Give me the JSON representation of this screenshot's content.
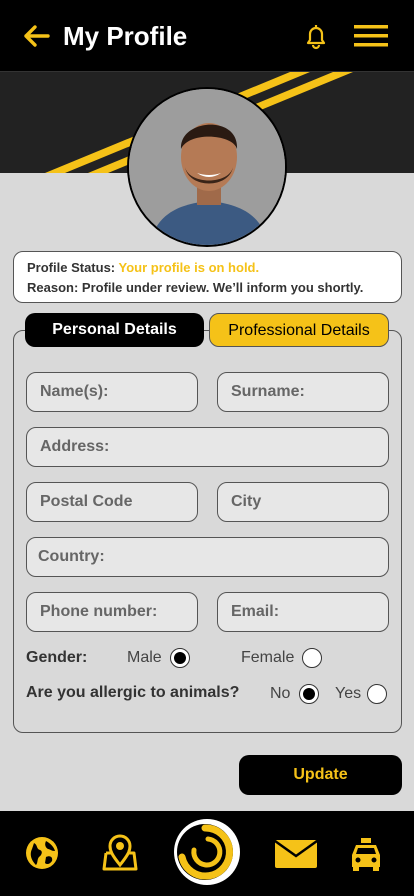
{
  "header": {
    "title": "My Profile"
  },
  "status": {
    "status_label": "Profile Status:",
    "status_value": "Your profile is on hold.",
    "reason_label": "Reason:",
    "reason_value": "Profile under review. We’ll inform you shortly."
  },
  "tabs": {
    "personal": "Personal Details",
    "professional": "Professional Details"
  },
  "fields": {
    "name": "Name(s):",
    "surname": "Surname:",
    "address": "Address:",
    "postal_code": "Postal Code",
    "city": "City",
    "country": "Country:",
    "phone": "Phone number:",
    "email": "Email:"
  },
  "gender": {
    "label": "Gender:",
    "male": "Male",
    "female": "Female",
    "selected": "Male"
  },
  "allergy": {
    "label": "Are you allergic to animals?",
    "no": "No",
    "yes": "Yes",
    "selected": "No"
  },
  "actions": {
    "update": "Update"
  },
  "nav": {
    "items": [
      "globe-icon",
      "map-pin-icon",
      "home-logo-icon",
      "mail-icon",
      "taxi-icon"
    ]
  },
  "colors": {
    "accent": "#f5c218",
    "dark": "#000000",
    "background": "#d9d9d9"
  }
}
